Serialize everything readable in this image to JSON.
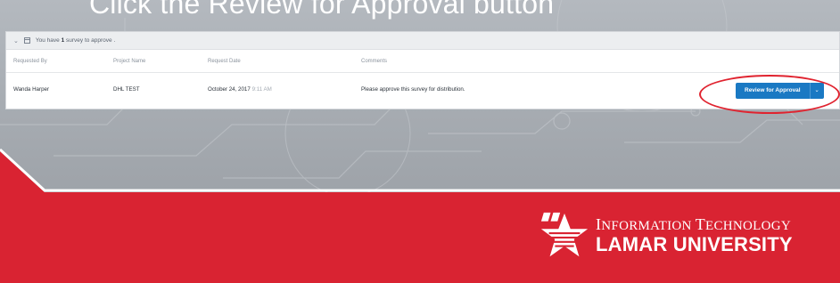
{
  "instruction": "Click the Review for Approval button",
  "panel": {
    "header_prefix": "You have",
    "header_count": "1",
    "header_suffix": "survey to approve .",
    "columns": {
      "requested_by": "Requested By",
      "project_name": "Project Name",
      "request_date": "Request Date",
      "comments": "Comments"
    },
    "row": {
      "requested_by": "Wanda Harper",
      "project_name": "DHL TEST",
      "date": "October 24, 2017",
      "time": "9:11 AM",
      "comment": "Please approve this survey for distribution."
    },
    "review_button_label": "Review for Approval"
  },
  "icons": {
    "collapse": "chevron-down-icon",
    "survey": "calendar-icon",
    "split_caret": "chevron-down-icon"
  },
  "logo": {
    "line1_caps_I": "I",
    "line1_rest_I": "NFORMATION ",
    "line1_caps_T": "T",
    "line1_rest_T": "ECHNOLOGY",
    "line2": "LAMAR UNIVERSITY"
  },
  "colors": {
    "brand_red": "#d92332",
    "button_blue": "#1a79c3",
    "highlight_red": "#e0232f"
  }
}
